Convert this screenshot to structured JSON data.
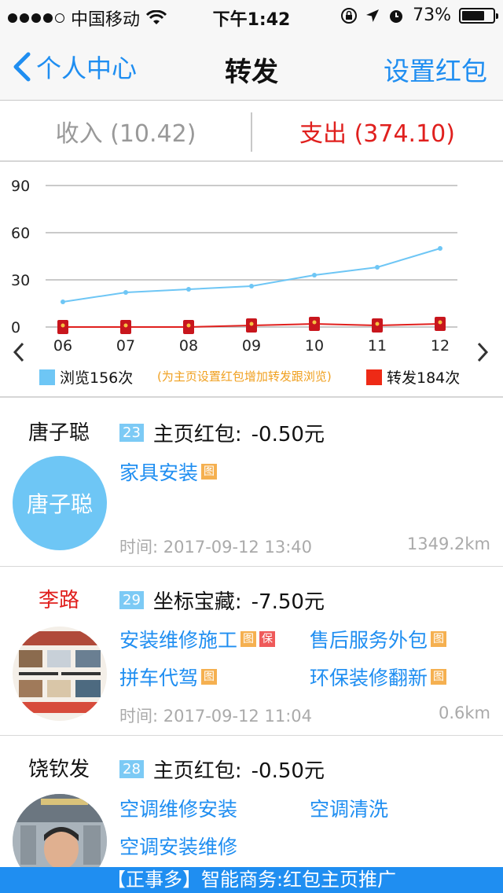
{
  "status": {
    "carrier": "中国移动",
    "time": "下午1:42",
    "battery": "73%",
    "battery_level": 0.73
  },
  "nav": {
    "back_label": "个人中心",
    "title": "转发",
    "right_label": "设置红包"
  },
  "tabs": {
    "income": "收入 (10.42)",
    "expense": "支出 (374.10)"
  },
  "chart_data": {
    "type": "line",
    "categories": [
      "06",
      "07",
      "08",
      "09",
      "10",
      "11",
      "12"
    ],
    "series": [
      {
        "name": "浏览156次",
        "color": "#6ec6f5",
        "values": [
          16,
          22,
          24,
          26,
          33,
          38,
          50
        ]
      },
      {
        "name": "转发184次",
        "color": "#e0201e",
        "values": [
          0,
          0,
          0,
          1,
          2,
          1,
          2
        ]
      }
    ],
    "yticks": [
      "90",
      "60",
      "30",
      "0"
    ],
    "ylim": [
      0,
      90
    ],
    "grid": true,
    "annotation": "(为主页设置红包增加转发跟浏览)"
  },
  "legend": {
    "browse": "浏览156次",
    "note": "(为主页设置红包增加转发跟浏览)",
    "forward": "转发184次"
  },
  "items": [
    {
      "name": "唐子聪",
      "avatar_text": "唐子聪",
      "badge": "23",
      "title": "主页红包:",
      "amount": "-0.50元",
      "tags": [
        "家具安装"
      ],
      "time": "时间: 2017-09-12 13:40",
      "distance": "1349.2km"
    },
    {
      "name": "李路",
      "badge": "29",
      "title": "坐标宝藏:",
      "amount": "-7.50元",
      "tags": [
        "安装维修施工",
        "售后服务外包",
        "拼车代驾",
        "环保装修翻新"
      ],
      "time": "时间: 2017-09-12 11:04",
      "distance": "0.6km"
    },
    {
      "name": "饶钦发",
      "badge": "28",
      "title": "主页红包:",
      "amount": "-0.50元",
      "tags": [
        "空调维修安装",
        "空调清洗",
        "空调安装维修"
      ]
    }
  ],
  "mini_labels": {
    "img": "图",
    "bao": "保"
  },
  "banner": "【正事多】智能商务:红包主页推广"
}
